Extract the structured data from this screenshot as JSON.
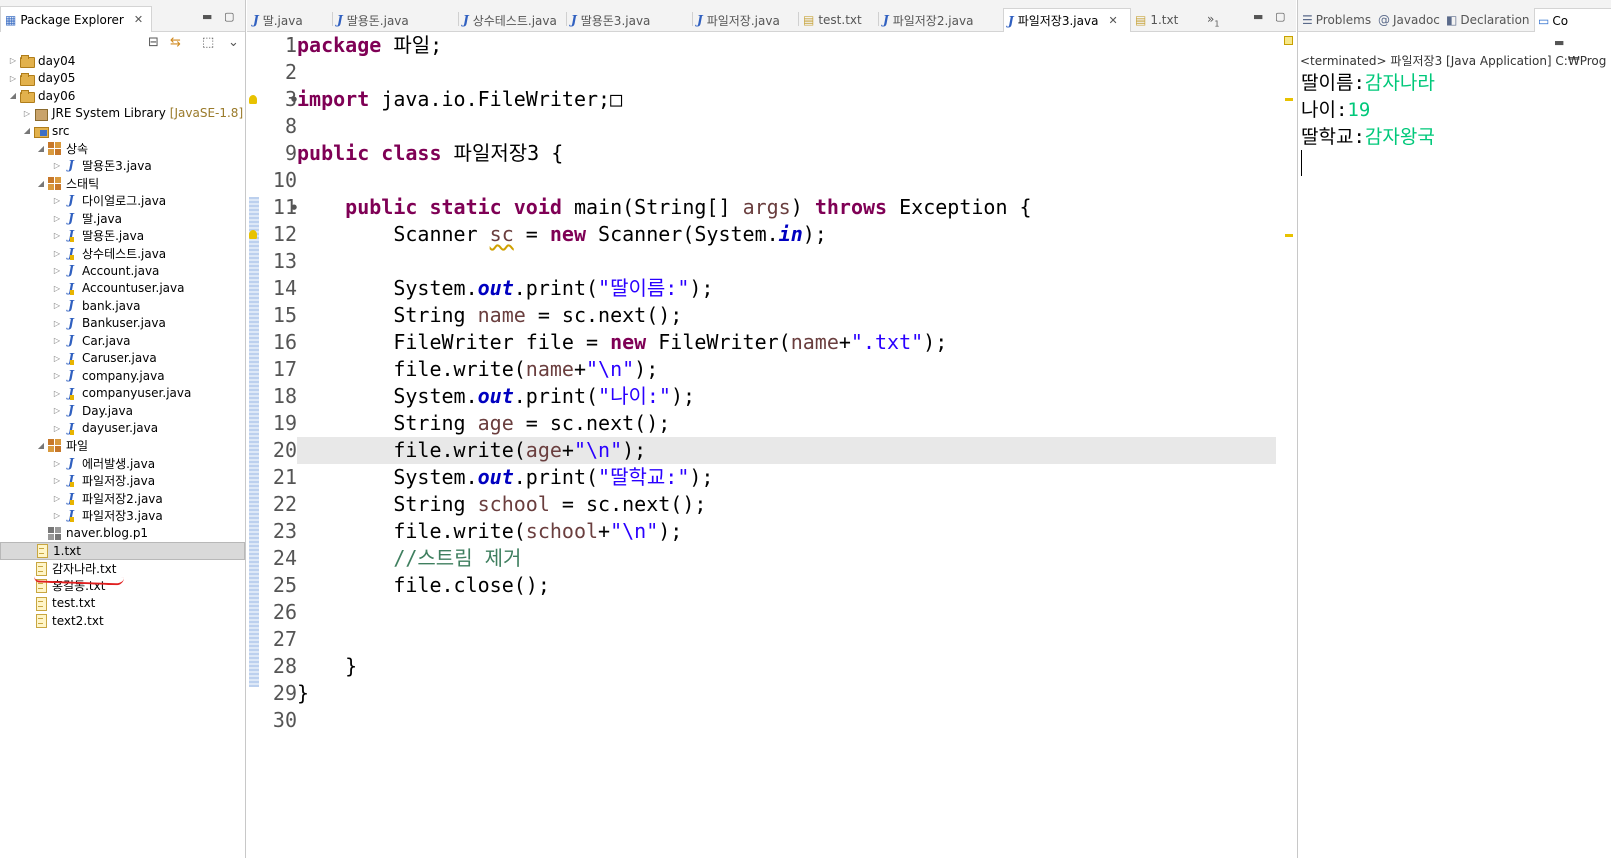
{
  "package_explorer": {
    "title": "Package Explorer",
    "tree": [
      {
        "label": "day04",
        "type": "project",
        "twisty": "▷"
      },
      {
        "label": "day05",
        "type": "project",
        "twisty": "▷"
      },
      {
        "label": "day06",
        "type": "project",
        "twisty": "◢"
      },
      {
        "label": "JRE System Library",
        "decoration": "[JavaSE-1.8]",
        "type": "library",
        "twisty": "▷"
      },
      {
        "label": "src",
        "type": "src",
        "twisty": "◢"
      },
      {
        "label": "상속",
        "type": "package",
        "twisty": "◢"
      },
      {
        "label": "딸용돈3.java",
        "type": "java",
        "twisty": "▷"
      },
      {
        "label": "스태틱",
        "type": "package",
        "twisty": "◢"
      },
      {
        "label": "다이얼로그.java",
        "type": "java",
        "twisty": "▷"
      },
      {
        "label": "딸.java",
        "type": "java",
        "twisty": "▷"
      },
      {
        "label": "딸용돈.java",
        "type": "java-warn",
        "twisty": "▷"
      },
      {
        "label": "상수테스트.java",
        "type": "java-warn",
        "twisty": "▷"
      },
      {
        "label": "Account.java",
        "type": "java",
        "twisty": "▷"
      },
      {
        "label": "Accountuser.java",
        "type": "java-warn",
        "twisty": "▷"
      },
      {
        "label": "bank.java",
        "type": "java",
        "twisty": "▷"
      },
      {
        "label": "Bankuser.java",
        "type": "java",
        "twisty": "▷"
      },
      {
        "label": "Car.java",
        "type": "java",
        "twisty": "▷"
      },
      {
        "label": "Caruser.java",
        "type": "java-warn",
        "twisty": "▷"
      },
      {
        "label": "company.java",
        "type": "java",
        "twisty": "▷"
      },
      {
        "label": "companyuser.java",
        "type": "java-warn",
        "twisty": "▷"
      },
      {
        "label": "Day.java",
        "type": "java",
        "twisty": "▷"
      },
      {
        "label": "dayuser.java",
        "type": "java-warn",
        "twisty": "▷"
      },
      {
        "label": "파일",
        "type": "package",
        "twisty": "◢"
      },
      {
        "label": "에러발생.java",
        "type": "java",
        "twisty": "▷"
      },
      {
        "label": "파일저장.java",
        "type": "java-warn",
        "twisty": "▷"
      },
      {
        "label": "파일저장2.java",
        "type": "java-warn",
        "twisty": "▷"
      },
      {
        "label": "파일저장3.java",
        "type": "java-warn",
        "twisty": "▷"
      },
      {
        "label": "naver.blog.p1",
        "type": "package-empty",
        "twisty": ""
      },
      {
        "label": "1.txt",
        "type": "txt",
        "twisty": "",
        "selected": true
      },
      {
        "label": "감자나라.txt",
        "type": "txt",
        "twisty": ""
      },
      {
        "label": "홍길동.txt",
        "type": "txt",
        "twisty": ""
      },
      {
        "label": "test.txt",
        "type": "txt",
        "twisty": ""
      },
      {
        "label": "text2.txt",
        "type": "txt",
        "twisty": ""
      }
    ]
  },
  "editor": {
    "tabs": [
      {
        "label": "딸.java",
        "icon": "java"
      },
      {
        "label": "딸용돈.java",
        "icon": "java"
      },
      {
        "label": "상수테스트.java",
        "icon": "java"
      },
      {
        "label": "딸용돈3.java",
        "icon": "java"
      },
      {
        "label": "파일저장.java",
        "icon": "java"
      },
      {
        "label": "test.txt",
        "icon": "txt"
      },
      {
        "label": "파일저장2.java",
        "icon": "java"
      },
      {
        "label": "파일저장3.java",
        "icon": "java",
        "active": true
      },
      {
        "label": "1.txt",
        "icon": "txt"
      }
    ],
    "overflow_label": "»",
    "overflow_count": "1",
    "line_numbers": [
      "1",
      "2",
      "3",
      "8",
      "9",
      "10",
      "11",
      "12",
      "13",
      "14",
      "15",
      "16",
      "17",
      "18",
      "19",
      "20",
      "21",
      "22",
      "23",
      "24",
      "25",
      "26",
      "27",
      "28",
      "29",
      "30"
    ],
    "code_lines": [
      "package 파일;",
      "",
      "import java.io.FileWriter;□",
      "",
      "public class 파일저장3 {",
      "",
      "    public static void main(String[] args) throws Exception {",
      "        Scanner sc = new Scanner(System.in);",
      "",
      "        System.out.print(\"딸이름:\");",
      "        String name = sc.next();",
      "        FileWriter file = new FileWriter(name+\".txt\");",
      "        file.write(name+\"\\n\");",
      "        System.out.print(\"나이:\");",
      "        String age = sc.next();",
      "        file.write(age+\"\\n\");",
      "        System.out.print(\"딸학교:\");",
      "        String school = sc.next();",
      "        file.write(school+\"\\n\");",
      "        //스트림 제거",
      "        file.close();",
      "",
      "",
      "    }",
      "}",
      ""
    ],
    "current_line": "20"
  },
  "console": {
    "tabs": [
      {
        "label": "Problems",
        "icon": "problems"
      },
      {
        "label": "Javadoc",
        "icon": "@"
      },
      {
        "label": "Declaration",
        "icon": "declaration"
      },
      {
        "label": "Co",
        "icon": "console",
        "active": true
      }
    ],
    "status": "<terminated> 파일저장3 [Java Application] C:₩Prog",
    "lines": [
      {
        "prompt": "딸이름:",
        "input": "감자나라"
      },
      {
        "prompt": "나이:",
        "input": "19"
      },
      {
        "prompt": "딸학교:",
        "input": "감자왕국"
      }
    ]
  },
  "colors": {
    "keyword": "#7f0055",
    "string": "#2a00ff",
    "static_field": "#0000c0",
    "local_var": "#6a3e3e",
    "comment": "#3f7f5f",
    "console_input": "#00c87a"
  }
}
